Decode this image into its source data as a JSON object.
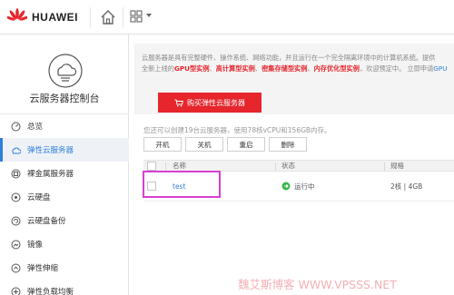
{
  "header": {
    "brand": "HUAWEI",
    "logo_icon": "huawei-logo-icon",
    "home_icon": "home-icon",
    "apps_icon": "apps-grid-icon",
    "brand_color": "#e6252c"
  },
  "sidebar": {
    "title": "云服务器控制台",
    "items": [
      {
        "label": "总览",
        "icon": "overview-icon",
        "active": false
      },
      {
        "label": "弹性云服务器",
        "icon": "ecs-icon",
        "active": true
      },
      {
        "label": "裸金属服务器",
        "icon": "bms-icon",
        "active": false
      },
      {
        "label": "云硬盘",
        "icon": "disk-icon",
        "active": false
      },
      {
        "label": "云硬盘备份",
        "icon": "disk-backup-icon",
        "active": false
      },
      {
        "label": "镜像",
        "icon": "image-icon",
        "active": false
      },
      {
        "label": "弹性伸缩",
        "icon": "autoscaling-icon",
        "active": false
      },
      {
        "label": "弹性负载均衡",
        "icon": "elb-icon",
        "active": false
      }
    ]
  },
  "banner": {
    "line1": "云服务器是具有完整硬件、操作系统、网络功能，并且运行在一个完全隔离环境中的计算机系统。提供",
    "line2_prefix": "全新上线的",
    "hl1": "GPU型实例",
    "sep1": "、",
    "hl2": "高计算型实例",
    "sep2": "、",
    "hl3": "密集存储型实例",
    "sep3": "、",
    "hl4": "内存优化型实例",
    "line2_suffix": "，欢迎预定中。 立即申请",
    "line2_tail": "GPU",
    "buy_label": "购买弹性云服务器"
  },
  "main": {
    "quota_text": "您还可以创建19台云服务器，使用78核vCPU和156GB内存。",
    "toolbar": {
      "start": "开机",
      "stop": "关机",
      "restart": "重启",
      "delete": "删除"
    },
    "columns": {
      "name": "名称",
      "status": "状态",
      "spec": "规格"
    },
    "rows": [
      {
        "name": "test",
        "status": "运行中",
        "spec": "2核 | 4GB"
      }
    ],
    "accent_color": "#2f7fd9",
    "status_color": "#3bb54a"
  },
  "watermark": "魏艾斯博客 WWW.VPSSS.NET"
}
